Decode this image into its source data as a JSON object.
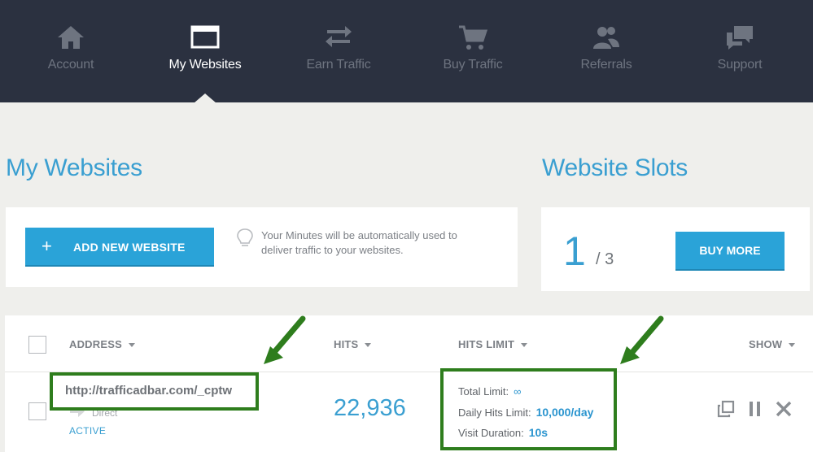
{
  "nav": {
    "items": [
      {
        "label": "Account",
        "icon": "home-icon"
      },
      {
        "label": "My Websites",
        "icon": "browser-window-icon"
      },
      {
        "label": "Earn Traffic",
        "icon": "swap-arrows-icon"
      },
      {
        "label": "Buy Traffic",
        "icon": "shopping-cart-icon"
      },
      {
        "label": "Referrals",
        "icon": "users-icon"
      },
      {
        "label": "Support",
        "icon": "chat-bubbles-icon"
      }
    ],
    "active": "My Websites"
  },
  "websites": {
    "title": "My Websites",
    "add_button": "ADD NEW WEBSITE",
    "add_icon": "+",
    "tip": [
      "Your Minutes will be automatically used to",
      "deliver traffic to your websites."
    ]
  },
  "slots": {
    "title": "Website Slots",
    "used": "1",
    "total": "/ 3",
    "buy_button": "BUY MORE"
  },
  "table": {
    "headers": {
      "address": "ADDRESS",
      "hits": "HITS",
      "hits_limit": "HITS LIMIT",
      "show": "SHOW"
    },
    "row": {
      "url": "http://trafficadbar.com/_cptw",
      "source": "Direct",
      "status": "ACTIVE",
      "hits": "22,936",
      "total_limit_label": "Total Limit:",
      "total_limit_value": "∞",
      "daily_label": "Daily Hits Limit:",
      "daily_value": "10,000/day",
      "duration_label": "Visit Duration:",
      "duration_value": "10s"
    }
  },
  "colors": {
    "nav_bg": "#2b3140",
    "accent": "#2aa3d8",
    "highlight": "#2e7d1d"
  }
}
